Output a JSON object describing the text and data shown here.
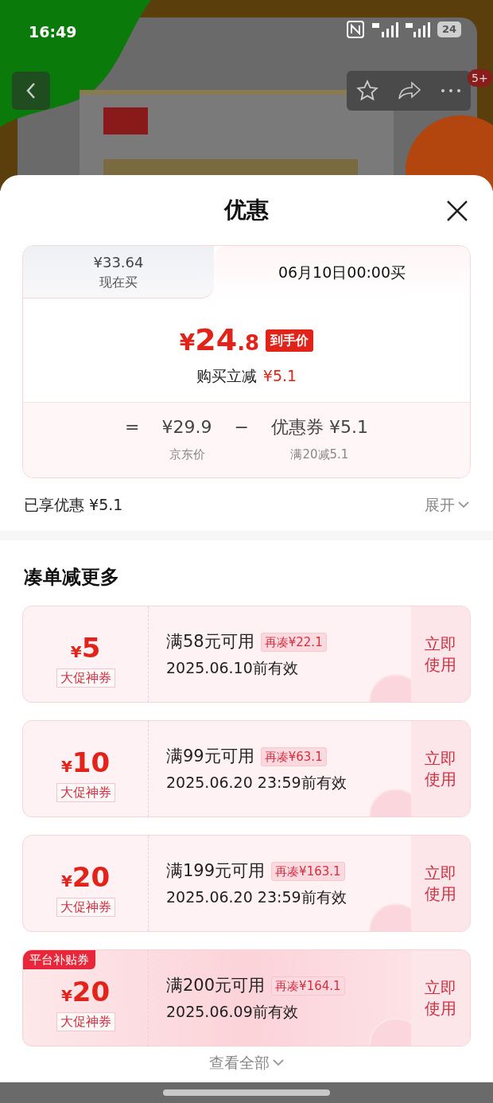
{
  "status_bar": {
    "time": "16:49",
    "battery": "24"
  },
  "nav": {
    "badge": "5+"
  },
  "sheet": {
    "title": "优惠",
    "price_card": {
      "tabs": [
        {
          "price": "¥33.64",
          "label": "现在买",
          "selected": false
        },
        {
          "label": "06月10日00:00买",
          "selected": true
        }
      ],
      "final_price": {
        "currency": "¥",
        "integer": "24",
        "decimal": ".8",
        "tag": "到手价"
      },
      "saving": {
        "label": "购买立减",
        "amount": "¥5.1"
      },
      "formula": [
        {
          "kind": "operator",
          "text": "="
        },
        {
          "kind": "term",
          "value": "¥29.9",
          "caption": "京东价"
        },
        {
          "kind": "operator",
          "text": "−"
        },
        {
          "kind": "term",
          "value": "优惠券 ¥5.1",
          "caption": "满20减5.1"
        }
      ]
    },
    "summary": {
      "label": "已享优惠 ¥5.1",
      "toggle": "展开"
    },
    "section_title": "凑单减更多",
    "coupons": [
      {
        "currency": "¥",
        "amount": "5",
        "tag": "大促神券",
        "condition": "满58元可用",
        "gap": "再凑¥22.1",
        "validity": "2025.06.10前有效",
        "action": "立即使用"
      },
      {
        "currency": "¥",
        "amount": "10",
        "tag": "大促神券",
        "condition": "满99元可用",
        "gap": "再凑¥63.1",
        "validity": "2025.06.20 23:59前有效",
        "action": "立即使用"
      },
      {
        "currency": "¥",
        "amount": "20",
        "tag": "大促神券",
        "condition": "满199元可用",
        "gap": "再凑¥163.1",
        "validity": "2025.06.20 23:59前有效",
        "action": "立即使用"
      },
      {
        "corner_label": "平台补贴券",
        "currency": "¥",
        "amount": "20",
        "tag": "大促神券",
        "condition": "满200元可用",
        "gap": "再凑¥164.1",
        "validity": "2025.06.09前有效",
        "action": "立即使用"
      }
    ],
    "view_all": "查看全部"
  }
}
